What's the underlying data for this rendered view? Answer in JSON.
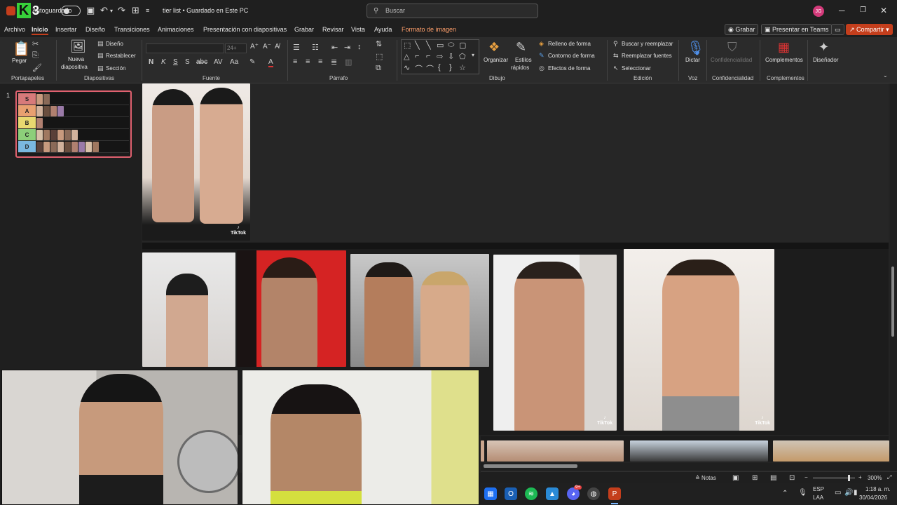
{
  "titlebar": {
    "logo_letter": "K",
    "logo_number": "3",
    "autosave": "Autoguardado",
    "doc_title": "tier list • Guardado en Este PC",
    "search_placeholder": "Buscar",
    "avatar": "JG"
  },
  "menu": {
    "tabs": [
      "Archivo",
      "Inicio",
      "Insertar",
      "Diseño",
      "Transiciones",
      "Animaciones",
      "Presentación con diapositivas",
      "Grabar",
      "Revisar",
      "Vista",
      "Ayuda",
      "Formato de imagen"
    ],
    "record": "Grabar",
    "teams": "Presentar en Teams",
    "share": "Compartir"
  },
  "ribbon": {
    "clipboard": {
      "paste": "Pegar",
      "group": "Portapapeles"
    },
    "slides": {
      "new": "Nueva",
      "new2": "diapositiva",
      "layout": "Diseño",
      "reset": "Restablecer",
      "section": "Sección",
      "group": "Diapositivas"
    },
    "font": {
      "size": "24+",
      "group": "Fuente"
    },
    "paragraph": {
      "group": "Párrafo"
    },
    "drawing": {
      "arrange": "Organizar",
      "styles": "Estilos",
      "styles2": "rápidos",
      "fill": "Relleno de forma",
      "outline": "Contorno de forma",
      "effects": "Efectos de forma",
      "group": "Dibujo"
    },
    "editing": {
      "find": "Buscar y reemplazar",
      "replace": "Reemplazar fuentes",
      "select": "Seleccionar",
      "group": "Edición"
    },
    "voice": {
      "dictate": "Dictar",
      "group": "Voz"
    },
    "sensitivity": {
      "label": "Confidencialidad",
      "group": "Confidencialidad"
    },
    "addins": {
      "label": "Complementos",
      "group": "Complementos"
    },
    "designer": {
      "label": "Diseñador"
    }
  },
  "slide_panel": {
    "slide_number": "1",
    "tiers": [
      {
        "label": "S",
        "color": "#d77a7a",
        "count": 2
      },
      {
        "label": "A",
        "color": "#e8a070",
        "count": 4
      },
      {
        "label": "B",
        "color": "#e8d870",
        "count": 1
      },
      {
        "label": "C",
        "color": "#8ccf7a",
        "count": 6
      },
      {
        "label": "D",
        "color": "#7ab8e0",
        "count": 9
      }
    ]
  },
  "photos": {
    "tiktok_label": "TikTok"
  },
  "statusbar": {
    "notes": "Notas",
    "zoom": "300%"
  },
  "taskbar": {
    "lang1": "ESP",
    "lang2": "LAA",
    "time": "1:18 a. m.",
    "date": "30/04/2026",
    "discord_badge": "9+"
  }
}
